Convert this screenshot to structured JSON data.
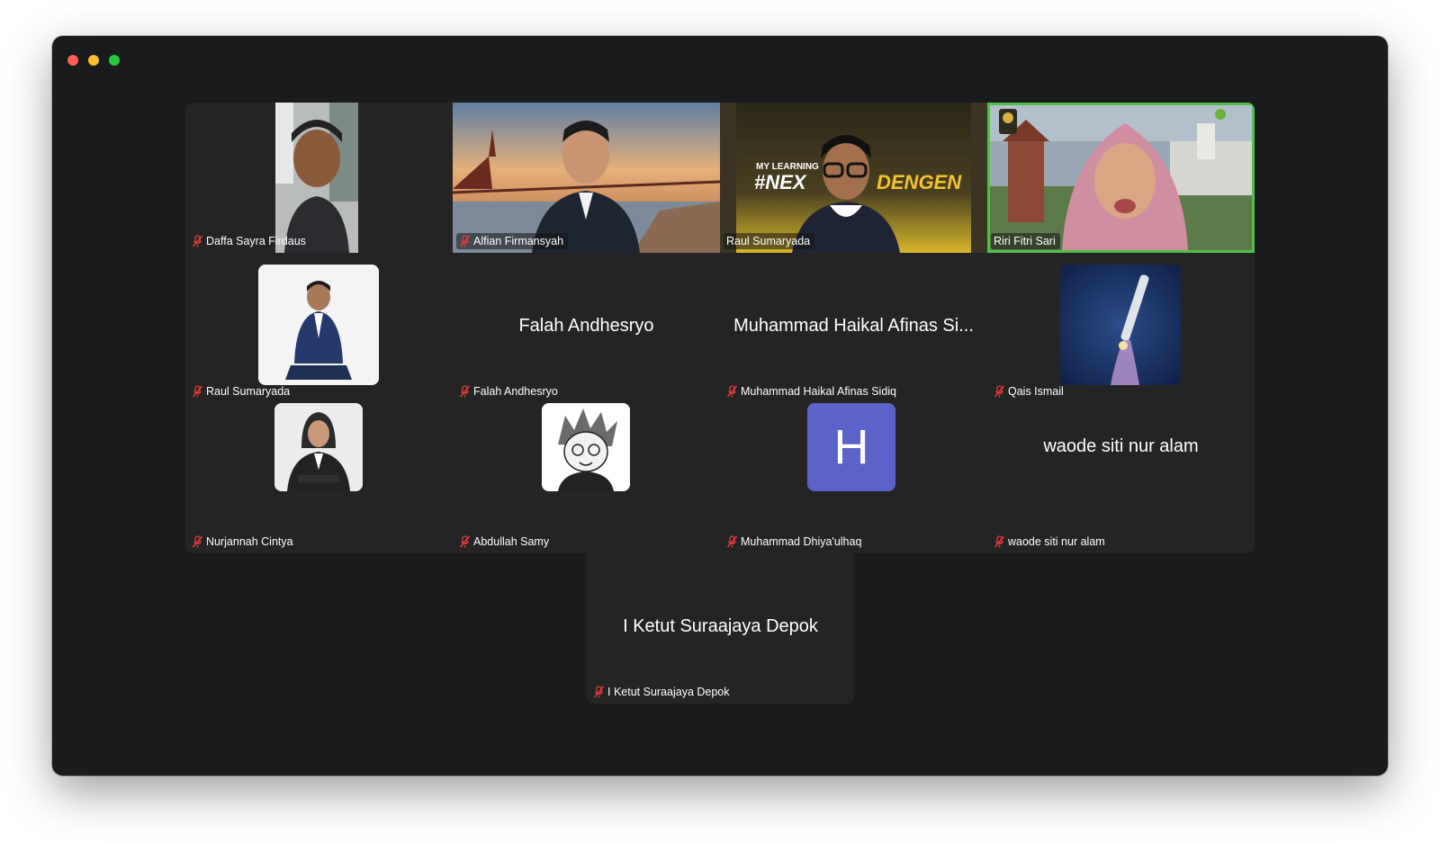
{
  "window": {
    "controls": [
      "close",
      "minimize",
      "maximize"
    ],
    "colors": {
      "close": "#fe5f57",
      "minimize": "#febc2e",
      "maximize": "#28c840",
      "active_speaker_border": "#4fc04a",
      "muted_icon": "#e5393b"
    }
  },
  "participants": [
    {
      "name": "Daffa Sayra Firdaus",
      "muted": true,
      "tile": "video"
    },
    {
      "name": "Alfian Firmansyah",
      "muted": true,
      "tile": "video"
    },
    {
      "name": "Raul Sumaryada",
      "muted": false,
      "tile": "video",
      "background_text": "MY LEARNING #NEXTGENDENGEN"
    },
    {
      "name": "Riri Fitri Sari",
      "muted": false,
      "tile": "video",
      "active_speaker": true
    },
    {
      "name": "Raul Sumaryada",
      "muted": true,
      "tile": "profile-photo"
    },
    {
      "name": "Falah Andhesryo",
      "muted": true,
      "tile": "name-only",
      "display_name": "Falah Andhesryo"
    },
    {
      "name": "Muhammad Haikal Afinas Sidiq",
      "muted": true,
      "tile": "name-only",
      "display_name": "Muhammad Haikal Afinas Si..."
    },
    {
      "name": "Qais Ismail",
      "muted": true,
      "tile": "profile-photo"
    },
    {
      "name": "Nurjannah Cintya",
      "muted": true,
      "tile": "profile-photo"
    },
    {
      "name": "Abdullah Samy",
      "muted": true,
      "tile": "profile-photo"
    },
    {
      "name": "Muhammad Dhiya'ulhaq",
      "muted": true,
      "tile": "letter-avatar",
      "avatar_letter": "H"
    },
    {
      "name": "waode siti nur alam",
      "muted": true,
      "tile": "name-only",
      "display_name": "waode siti nur alam"
    },
    {
      "name": "I Ketut Suraajaya Depok",
      "muted": true,
      "tile": "name-only",
      "display_name": "I Ketut Suraajaya Depok"
    }
  ]
}
